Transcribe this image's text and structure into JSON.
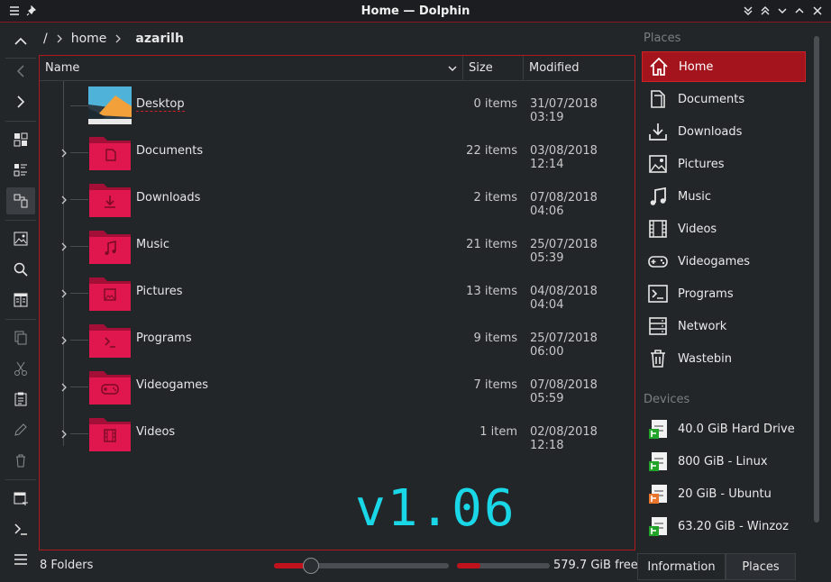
{
  "window": {
    "title": "Home — Dolphin"
  },
  "breadcrumb": [
    {
      "label": "/",
      "bold": false
    },
    {
      "label": "home",
      "bold": false
    },
    {
      "label": "azarilh",
      "bold": true
    }
  ],
  "columns": {
    "name": "Name",
    "size": "Size",
    "modified": "Modified"
  },
  "files": [
    {
      "name": "Desktop",
      "size": "0 items",
      "modified": "31/07/2018 03:19",
      "icon": "desktop-thumbnail",
      "expandable": false
    },
    {
      "name": "Documents",
      "size": "22 items",
      "modified": "03/08/2018 12:14",
      "icon": "folder-documents-icon",
      "expandable": true
    },
    {
      "name": "Downloads",
      "size": "2 items",
      "modified": "07/08/2018 04:06",
      "icon": "folder-downloads-icon",
      "expandable": true
    },
    {
      "name": "Music",
      "size": "21 items",
      "modified": "25/07/2018 05:39",
      "icon": "folder-music-icon",
      "expandable": true
    },
    {
      "name": "Pictures",
      "size": "13 items",
      "modified": "04/08/2018 04:04",
      "icon": "folder-pictures-icon",
      "expandable": true
    },
    {
      "name": "Programs",
      "size": "9 items",
      "modified": "25/07/2018 06:00",
      "icon": "folder-programs-icon",
      "expandable": true
    },
    {
      "name": "Videogames",
      "size": "7 items",
      "modified": "07/08/2018 05:59",
      "icon": "folder-videogames-icon",
      "expandable": true
    },
    {
      "name": "Videos",
      "size": "1 item",
      "modified": "02/08/2018 12:18",
      "icon": "folder-videos-icon",
      "expandable": true
    }
  ],
  "watermark": "v1.06",
  "places": {
    "header": "Places",
    "items": [
      {
        "label": "Home",
        "icon": "home-icon",
        "active": true
      },
      {
        "label": "Documents",
        "icon": "documents-icon",
        "active": false
      },
      {
        "label": "Downloads",
        "icon": "downloads-icon",
        "active": false
      },
      {
        "label": "Pictures",
        "icon": "pictures-icon",
        "active": false
      },
      {
        "label": "Music",
        "icon": "music-icon",
        "active": false
      },
      {
        "label": "Videos",
        "icon": "videos-icon",
        "active": false
      },
      {
        "label": "Videogames",
        "icon": "gamepad-icon",
        "active": false
      },
      {
        "label": "Programs",
        "icon": "terminal-icon",
        "active": false
      },
      {
        "label": "Network",
        "icon": "network-icon",
        "active": false
      },
      {
        "label": "Wastebin",
        "icon": "trash-icon",
        "active": false
      }
    ]
  },
  "devices": {
    "header": "Devices",
    "items": [
      {
        "label": "40.0 GiB Hard Drive",
        "icon": "drive-icon",
        "accent": "#22a32a"
      },
      {
        "label": "800 GiB - Linux",
        "icon": "drive-icon",
        "accent": "#22a32a"
      },
      {
        "label": "20 GiB - Ubuntu",
        "icon": "drive-icon",
        "accent": "#e9742b"
      },
      {
        "label": "63.20 GiB - Winzoz",
        "icon": "drive-icon",
        "accent": "#22a32a"
      }
    ]
  },
  "status": {
    "folders": "8 Folders",
    "free": "579.7 GiB free",
    "zoom_fraction": 0.21,
    "used_fraction": 0.25
  },
  "panel_tabs": [
    {
      "label": "Information",
      "active": false
    },
    {
      "label": "Places",
      "active": true
    }
  ],
  "colors": {
    "accent": "#b01822",
    "folder": "#e0174f",
    "folder_dark": "#a30f36",
    "watermark": "#19d7e6"
  }
}
